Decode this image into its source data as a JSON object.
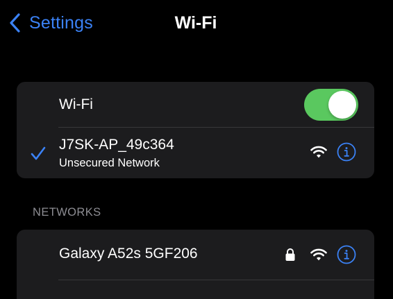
{
  "nav": {
    "back_label": "Settings",
    "title": "Wi-Fi"
  },
  "wifi_toggle": {
    "label": "Wi-Fi",
    "enabled": true,
    "on_color": "#5ac85f"
  },
  "current_network": {
    "name": "J7SK-AP_49c364",
    "subtitle": "Unsecured Network",
    "connected": true,
    "signal_icon": "wifi-icon",
    "info_icon": "info-icon"
  },
  "networks_section": {
    "header": "NETWORKS",
    "items": [
      {
        "name": "Galaxy A52s 5GF206",
        "secured": true,
        "lock_icon": "lock-icon",
        "signal_icon": "wifi-icon",
        "info_icon": "info-icon"
      }
    ]
  },
  "colors": {
    "accent": "#3b82f6",
    "background": "#000000",
    "group_background": "#1c1c1e",
    "secondary_text": "#8d8d93",
    "separator": "#38383a"
  }
}
